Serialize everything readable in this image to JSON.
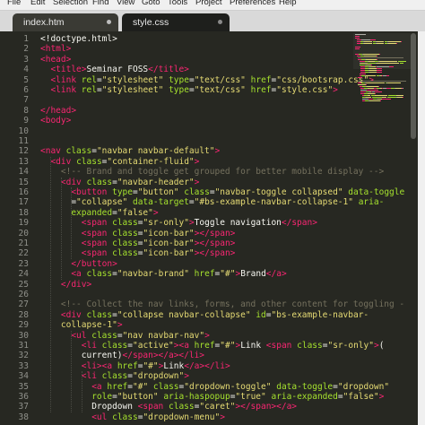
{
  "menu": [
    "File",
    "Edit",
    "Selection",
    "Find",
    "View",
    "Goto",
    "Tools",
    "Project",
    "Preferences",
    "Help"
  ],
  "tabs": [
    {
      "label": "index.htm",
      "active": true
    },
    {
      "label": "style.css",
      "active": false
    }
  ],
  "line_numbers": [
    "1",
    "2",
    "3",
    "4",
    "5",
    "6",
    "7",
    "8",
    "9",
    "10",
    "11",
    "12",
    "13",
    "14",
    "15",
    "16",
    "17",
    "18",
    "19",
    "20",
    "21",
    "22",
    "23",
    "24",
    "25",
    "26",
    "27",
    "28",
    "29",
    "30",
    "31",
    "32",
    "33",
    "34",
    "35",
    "36",
    "37",
    "38"
  ],
  "code": [
    [
      [
        "tx",
        "<!doctype.html>"
      ]
    ],
    [
      [
        "tg",
        "<html>"
      ]
    ],
    [
      [
        "tg",
        "<head>"
      ]
    ],
    [
      [
        "tx",
        "  "
      ],
      [
        "tg",
        "<title>"
      ],
      [
        "tx",
        "Seminar FOSS"
      ],
      [
        "tg",
        "</title>"
      ]
    ],
    [
      [
        "tx",
        "  "
      ],
      [
        "tg",
        "<link "
      ],
      [
        "at",
        "rel"
      ],
      [
        "tx",
        "="
      ],
      [
        "st",
        "\"stylesheet\""
      ],
      [
        "tx",
        " "
      ],
      [
        "at",
        "type"
      ],
      [
        "tx",
        "="
      ],
      [
        "st",
        "\"text/css\""
      ],
      [
        "tx",
        " "
      ],
      [
        "at",
        "href"
      ],
      [
        "tx",
        "="
      ],
      [
        "st",
        "\"css/bootsrap.css\""
      ],
      [
        "tg",
        ">"
      ]
    ],
    [
      [
        "tx",
        "  "
      ],
      [
        "tg",
        "<link "
      ],
      [
        "at",
        "rel"
      ],
      [
        "tx",
        "="
      ],
      [
        "st",
        "\"stylesheet\""
      ],
      [
        "tx",
        " "
      ],
      [
        "at",
        "type"
      ],
      [
        "tx",
        "="
      ],
      [
        "st",
        "\"text/css\""
      ],
      [
        "tx",
        " "
      ],
      [
        "at",
        "href"
      ],
      [
        "tx",
        "="
      ],
      [
        "st",
        "\"style.css\""
      ],
      [
        "tg",
        ">"
      ]
    ],
    [],
    [
      [
        "tg",
        "</head>"
      ]
    ],
    [
      [
        "tg",
        "<body>"
      ]
    ],
    [],
    [],
    [
      [
        "tg",
        "<nav "
      ],
      [
        "at",
        "class"
      ],
      [
        "tx",
        "="
      ],
      [
        "st",
        "\"navbar navbar-default\""
      ],
      [
        "tg",
        ">"
      ]
    ],
    [
      [
        "tx",
        "  "
      ],
      [
        "tg",
        "<div "
      ],
      [
        "at",
        "class"
      ],
      [
        "tx",
        "="
      ],
      [
        "st",
        "\"container-fluid\""
      ],
      [
        "tg",
        ">"
      ]
    ],
    [
      [
        "tx",
        "    "
      ],
      [
        "cm",
        "<!-- Brand and toggle get grouped for better mobile display -->"
      ]
    ],
    [
      [
        "tx",
        "    "
      ],
      [
        "tg",
        "<div "
      ],
      [
        "at",
        "class"
      ],
      [
        "tx",
        "="
      ],
      [
        "st",
        "\"navbar-header\""
      ],
      [
        "tg",
        ">"
      ]
    ],
    [
      [
        "tx",
        "      "
      ],
      [
        "tg",
        "<button "
      ],
      [
        "at",
        "type"
      ],
      [
        "tx",
        "="
      ],
      [
        "st",
        "\"button\""
      ],
      [
        "tx",
        " "
      ],
      [
        "at",
        "class"
      ],
      [
        "tx",
        "="
      ],
      [
        "st",
        "\"navbar-toggle collapsed\""
      ],
      [
        "tx",
        " "
      ],
      [
        "at",
        "data-toggle"
      ]
    ],
    [
      [
        "tx",
        "      ="
      ],
      [
        "st",
        "\"collapse\""
      ],
      [
        "tx",
        " "
      ],
      [
        "at",
        "data-target"
      ],
      [
        "tx",
        "="
      ],
      [
        "st",
        "\"#bs-example-navbar-collapse-1\""
      ],
      [
        "tx",
        " "
      ],
      [
        "at",
        "aria-"
      ]
    ],
    [
      [
        "tx",
        "      "
      ],
      [
        "at",
        "expanded"
      ],
      [
        "tx",
        "="
      ],
      [
        "st",
        "\"false\""
      ],
      [
        "tg",
        ">"
      ]
    ],
    [
      [
        "tx",
        "        "
      ],
      [
        "tg",
        "<span "
      ],
      [
        "at",
        "class"
      ],
      [
        "tx",
        "="
      ],
      [
        "st",
        "\"sr-only\""
      ],
      [
        "tg",
        ">"
      ],
      [
        "tx",
        "Toggle navigation"
      ],
      [
        "tg",
        "</span>"
      ]
    ],
    [
      [
        "tx",
        "        "
      ],
      [
        "tg",
        "<span "
      ],
      [
        "at",
        "class"
      ],
      [
        "tx",
        "="
      ],
      [
        "st",
        "\"icon-bar\""
      ],
      [
        "tg",
        "></span>"
      ]
    ],
    [
      [
        "tx",
        "        "
      ],
      [
        "tg",
        "<span "
      ],
      [
        "at",
        "class"
      ],
      [
        "tx",
        "="
      ],
      [
        "st",
        "\"icon-bar\""
      ],
      [
        "tg",
        "></span>"
      ]
    ],
    [
      [
        "tx",
        "        "
      ],
      [
        "tg",
        "<span "
      ],
      [
        "at",
        "class"
      ],
      [
        "tx",
        "="
      ],
      [
        "st",
        "\"icon-bar\""
      ],
      [
        "tg",
        "></span>"
      ]
    ],
    [
      [
        "tx",
        "      "
      ],
      [
        "tg",
        "</button>"
      ]
    ],
    [
      [
        "tx",
        "      "
      ],
      [
        "tg",
        "<a "
      ],
      [
        "at",
        "class"
      ],
      [
        "tx",
        "="
      ],
      [
        "st",
        "\"navbar-brand\""
      ],
      [
        "tx",
        " "
      ],
      [
        "at",
        "href"
      ],
      [
        "tx",
        "="
      ],
      [
        "st",
        "\"#\""
      ],
      [
        "tg",
        ">"
      ],
      [
        "tx",
        "Brand"
      ],
      [
        "tg",
        "</a>"
      ]
    ],
    [
      [
        "tx",
        "    "
      ],
      [
        "tg",
        "</div>"
      ]
    ],
    [],
    [
      [
        "tx",
        "    "
      ],
      [
        "cm",
        "<!-- Collect the nav links, forms, and other content for toggling -"
      ]
    ],
    [
      [
        "tx",
        "    "
      ],
      [
        "tg",
        "<div "
      ],
      [
        "at",
        "class"
      ],
      [
        "tx",
        "="
      ],
      [
        "st",
        "\"collapse navbar-collapse\""
      ],
      [
        "tx",
        " "
      ],
      [
        "at",
        "id"
      ],
      [
        "tx",
        "="
      ],
      [
        "st",
        "\"bs-example-navbar-"
      ]
    ],
    [
      [
        "tx",
        "    "
      ],
      [
        "st",
        "collapse-1\""
      ],
      [
        "tg",
        ">"
      ]
    ],
    [
      [
        "tx",
        "      "
      ],
      [
        "tg",
        "<ul "
      ],
      [
        "at",
        "class"
      ],
      [
        "tx",
        "="
      ],
      [
        "st",
        "\"nav navbar-nav\""
      ],
      [
        "tg",
        ">"
      ]
    ],
    [
      [
        "tx",
        "        "
      ],
      [
        "tg",
        "<li "
      ],
      [
        "at",
        "class"
      ],
      [
        "tx",
        "="
      ],
      [
        "st",
        "\"active\""
      ],
      [
        "tg",
        "><a "
      ],
      [
        "at",
        "href"
      ],
      [
        "tx",
        "="
      ],
      [
        "st",
        "\"#\""
      ],
      [
        "tg",
        ">"
      ],
      [
        "tx",
        "Link "
      ],
      [
        "tg",
        "<span "
      ],
      [
        "at",
        "class"
      ],
      [
        "tx",
        "="
      ],
      [
        "st",
        "\"sr-only\""
      ],
      [
        "tg",
        ">"
      ],
      [
        "tx",
        "("
      ]
    ],
    [
      [
        "tx",
        "        current)"
      ],
      [
        "tg",
        "</span></a></li>"
      ]
    ],
    [
      [
        "tx",
        "        "
      ],
      [
        "tg",
        "<li><a "
      ],
      [
        "at",
        "href"
      ],
      [
        "tx",
        "="
      ],
      [
        "st",
        "\"#\""
      ],
      [
        "tg",
        ">"
      ],
      [
        "tx",
        "Link"
      ],
      [
        "tg",
        "</a></li>"
      ]
    ],
    [
      [
        "tx",
        "        "
      ],
      [
        "tg",
        "<li "
      ],
      [
        "at",
        "class"
      ],
      [
        "tx",
        "="
      ],
      [
        "st",
        "\"dropdown\""
      ],
      [
        "tg",
        ">"
      ]
    ],
    [
      [
        "tx",
        "          "
      ],
      [
        "tg",
        "<a "
      ],
      [
        "at",
        "href"
      ],
      [
        "tx",
        "="
      ],
      [
        "st",
        "\"#\""
      ],
      [
        "tx",
        " "
      ],
      [
        "at",
        "class"
      ],
      [
        "tx",
        "="
      ],
      [
        "st",
        "\"dropdown-toggle\""
      ],
      [
        "tx",
        " "
      ],
      [
        "at",
        "data-toggle"
      ],
      [
        "tx",
        "="
      ],
      [
        "st",
        "\"dropdown\""
      ]
    ],
    [
      [
        "tx",
        "          "
      ],
      [
        "at",
        "role"
      ],
      [
        "tx",
        "="
      ],
      [
        "st",
        "\"button\""
      ],
      [
        "tx",
        " "
      ],
      [
        "at",
        "aria-haspopup"
      ],
      [
        "tx",
        "="
      ],
      [
        "st",
        "\"true\""
      ],
      [
        "tx",
        " "
      ],
      [
        "at",
        "aria-expanded"
      ],
      [
        "tx",
        "="
      ],
      [
        "st",
        "\"false\""
      ],
      [
        "tg",
        ">"
      ]
    ],
    [
      [
        "tx",
        "          Dropdown "
      ],
      [
        "tg",
        "<span "
      ],
      [
        "at",
        "class"
      ],
      [
        "tx",
        "="
      ],
      [
        "st",
        "\"caret\""
      ],
      [
        "tg",
        "></span></a>"
      ]
    ],
    [
      [
        "tx",
        "          "
      ],
      [
        "tg",
        "<ul "
      ],
      [
        "at",
        "class"
      ],
      [
        "tx",
        "="
      ],
      [
        "st",
        "\"dropdown-menu\""
      ],
      [
        "tg",
        ">"
      ]
    ]
  ],
  "colors": {
    "background": "#272822",
    "tag": "#f92672",
    "attribute": "#a6e22e",
    "string": "#e6db74",
    "text": "#f8f8f2",
    "comment": "#75715e",
    "line_number": "#8f908a"
  }
}
